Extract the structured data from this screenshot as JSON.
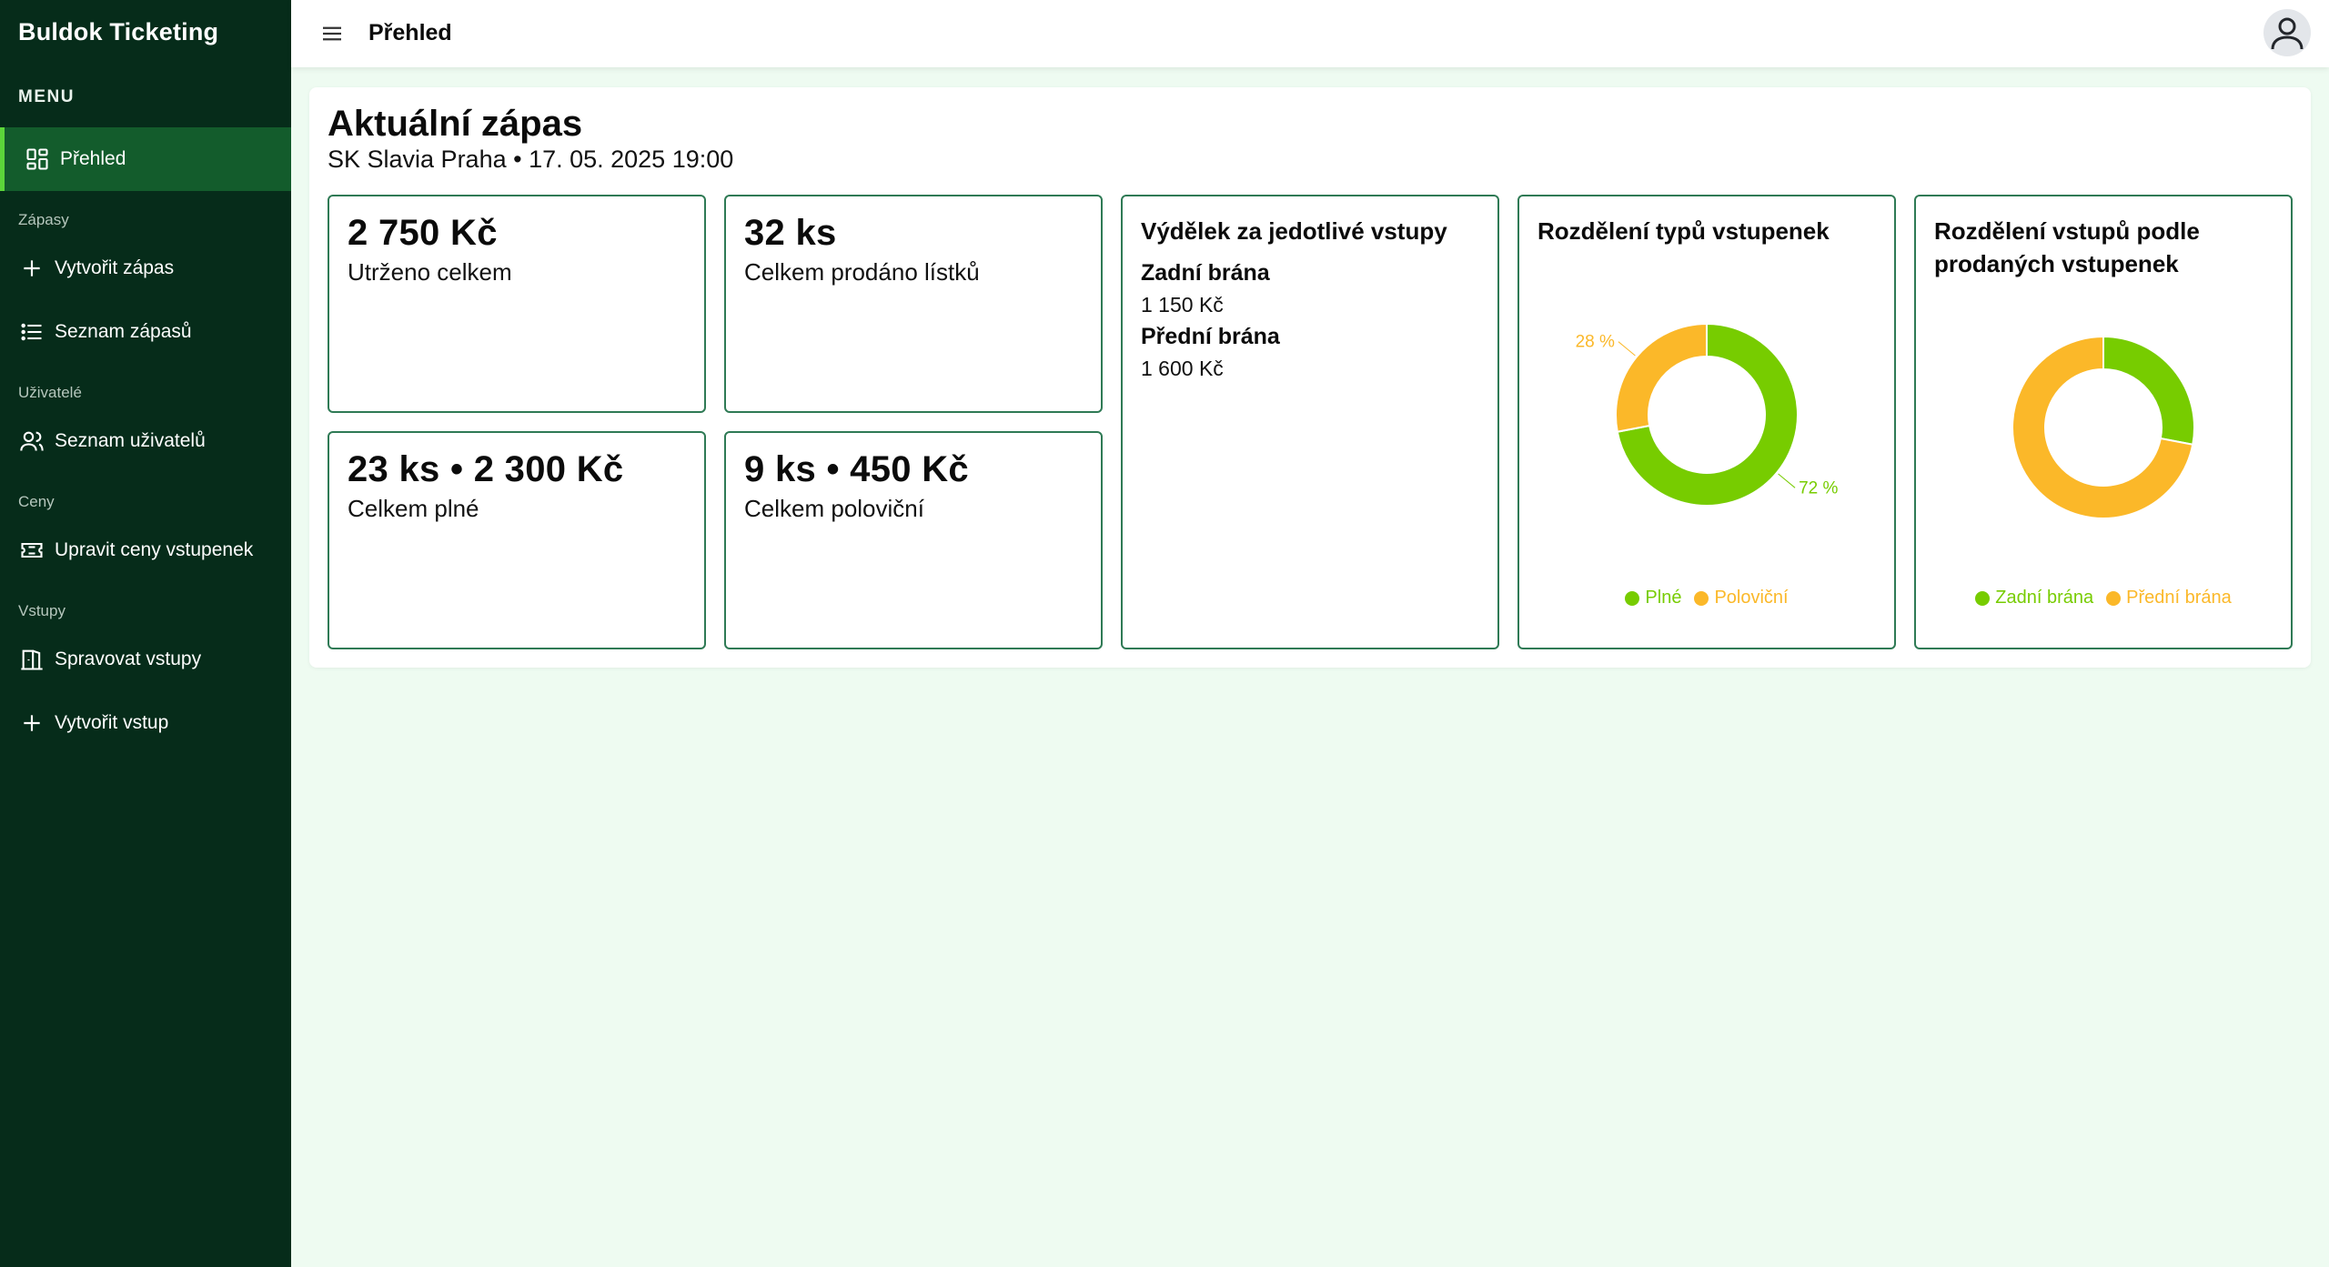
{
  "app": {
    "title": "Buldok Ticketing"
  },
  "sidebar": {
    "menu_heading": "MENU",
    "active_item": {
      "label": "Přehled",
      "icon": "grid-icon"
    },
    "sections": [
      {
        "label": "Zápasy",
        "items": [
          {
            "label": "Vytvořit zápas",
            "icon": "plus-icon"
          },
          {
            "label": "Seznam zápasů",
            "icon": "list-icon"
          }
        ]
      },
      {
        "label": "Uživatelé",
        "items": [
          {
            "label": "Seznam uživatelů",
            "icon": "users-icon"
          }
        ]
      },
      {
        "label": "Ceny",
        "items": [
          {
            "label": "Upravit ceny vstupenek",
            "icon": "ticket-icon"
          }
        ]
      },
      {
        "label": "Vstupy",
        "items": [
          {
            "label": "Spravovat vstupy",
            "icon": "gate-icon"
          },
          {
            "label": "Vytvořit vstup",
            "icon": "plus-icon"
          }
        ]
      }
    ]
  },
  "topbar": {
    "title": "Přehled",
    "menu_icon": "hamburger-icon",
    "avatar_icon": "user-avatar-icon"
  },
  "overview": {
    "title": "Aktuální zápas",
    "subtitle": "SK Slavia Praha • 17. 05. 2025 19:00",
    "stats": [
      {
        "value": "2 750 Kč",
        "label": "Utrženo celkem"
      },
      {
        "value": "32 ks",
        "label": "Celkem prodáno lístků"
      },
      {
        "value": "23 ks • 2 300 Kč",
        "label": "Celkem plné"
      },
      {
        "value": "9 ks • 450 Kč",
        "label": "Celkem poloviční"
      }
    ],
    "earnings": {
      "title": "Výdělek za jedotlivé vstupy",
      "gates": [
        {
          "name": "Zadní brána",
          "value": "1 150 Kč"
        },
        {
          "name": "Přední brána",
          "value": "1 600 Kč"
        }
      ]
    }
  },
  "colors": {
    "green": "#77cc00",
    "orange": "#fbb829",
    "sidebar": "#062c1a",
    "accent": "#135c2c"
  },
  "chart_data": [
    {
      "type": "pie",
      "title": "Rozdělení typů vstupenek",
      "categories": [
        "Plné",
        "Poloviční"
      ],
      "values": [
        72,
        28
      ],
      "data_labels": [
        "72 %",
        "28 %"
      ],
      "colors": [
        "#77cc00",
        "#fbb829"
      ],
      "donut": true,
      "legend": "bottom"
    },
    {
      "type": "pie",
      "title": "Rozdělení vstupů podle prodaných vstupenek",
      "categories": [
        "Zadní brána",
        "Přední brána"
      ],
      "values": [
        28,
        72
      ],
      "colors": [
        "#77cc00",
        "#fbb829"
      ],
      "donut": true,
      "legend": "bottom"
    }
  ]
}
